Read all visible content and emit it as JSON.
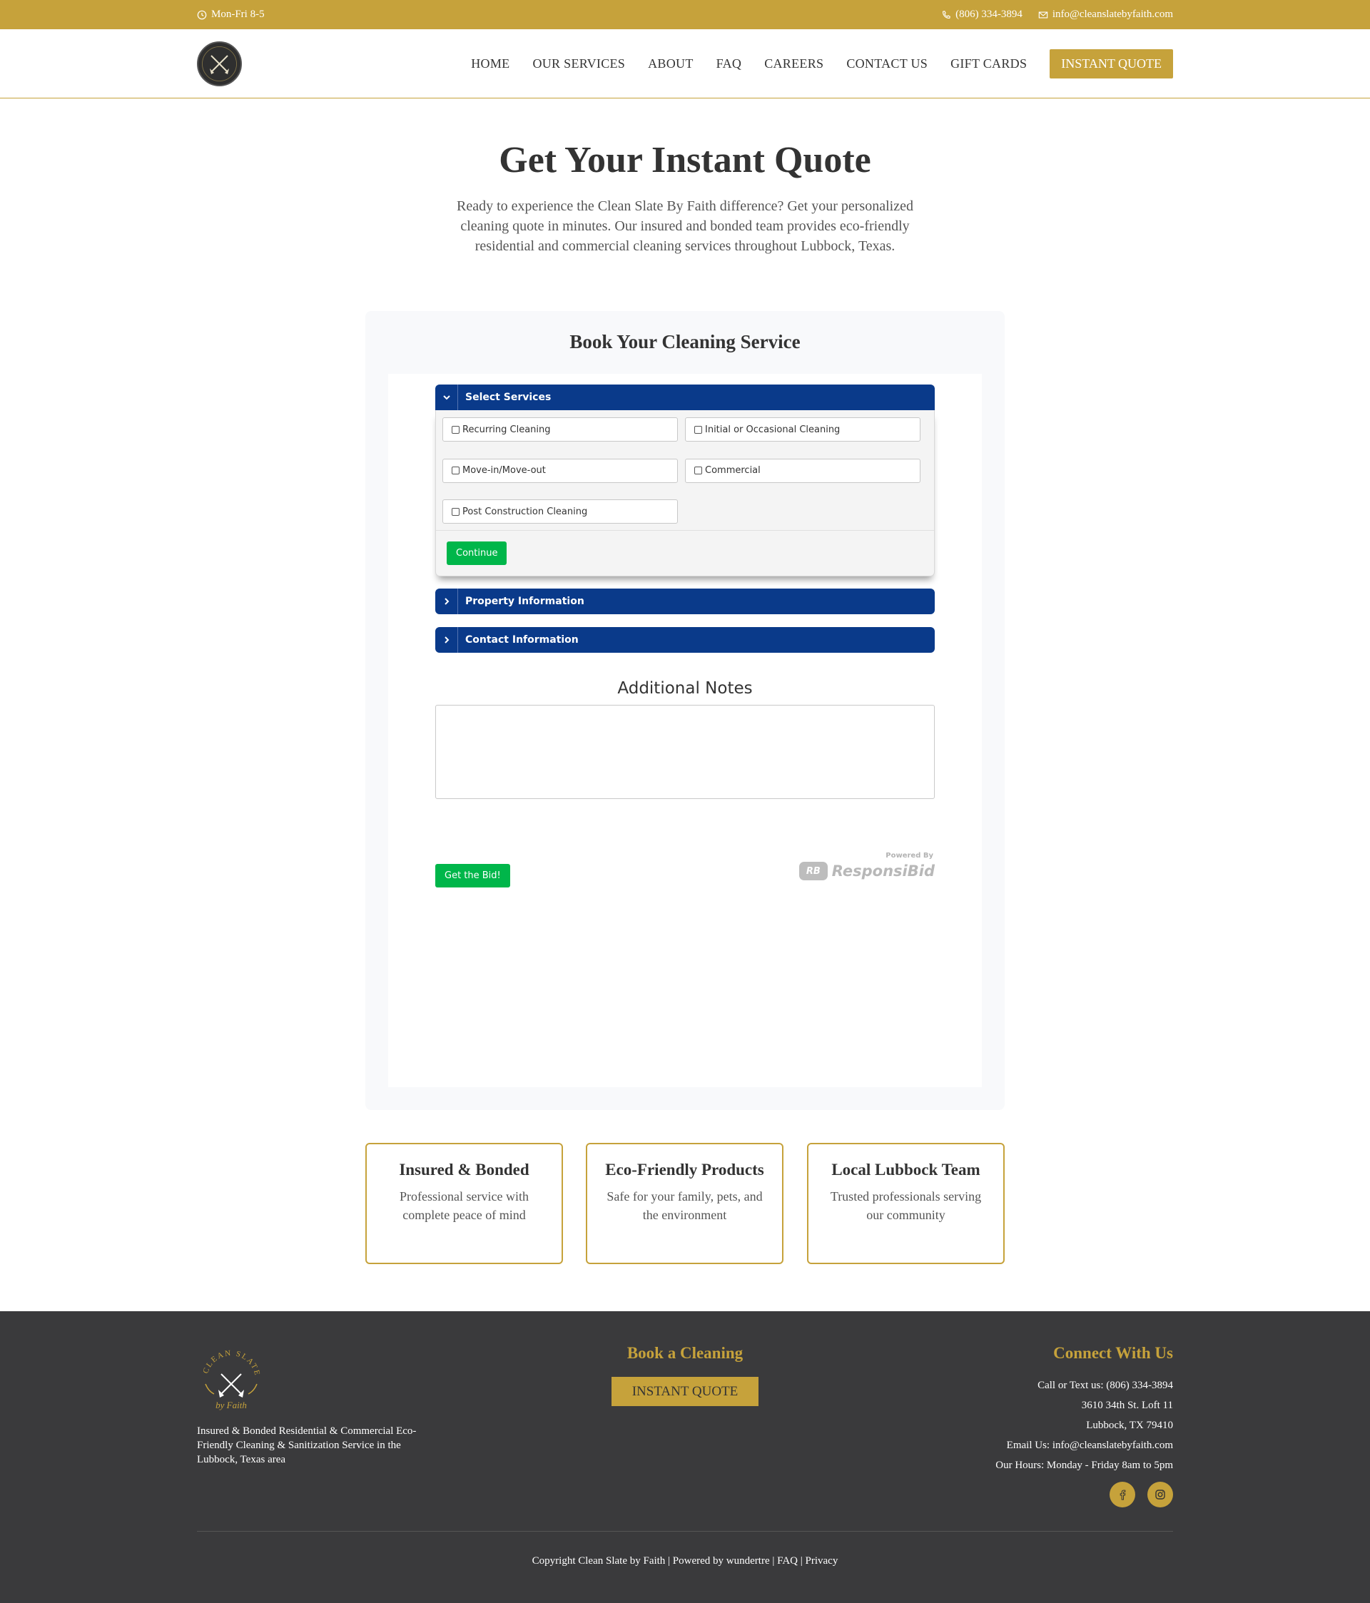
{
  "topbar": {
    "hours": "Mon-Fri 8-5",
    "phone": "(806) 334-3894",
    "email": "info@cleanslatebyfaith.com",
    "bg_color": "#c6a23b"
  },
  "header": {
    "nav": [
      "HOME",
      "OUR SERVICES",
      "ABOUT",
      "FAQ",
      "CAREERS",
      "CONTACT US",
      "GIFT CARDS"
    ],
    "cta": "INSTANT QUOTE"
  },
  "hero": {
    "title": "Get Your Instant Quote",
    "subtitle": "Ready to experience the Clean Slate By Faith difference? Get your personalized cleaning quote in minutes. Our insured and bonded team provides eco-friendly residential and commercial cleaning services throughout Lubbock, Texas."
  },
  "booking": {
    "title": "Book Your Cleaning Service",
    "sections": {
      "services": "Select Services",
      "property": "Property Information",
      "contact": "Contact Information"
    },
    "services": [
      "Recurring Cleaning",
      "Initial or Occasional Cleaning",
      "Move-in/Move-out",
      "Commercial",
      "Post Construction Cleaning"
    ],
    "continue_label": "Continue",
    "notes_title": "Additional Notes",
    "notes_value": "",
    "submit_label": "Get the Bid!",
    "powered_by": "Powered By",
    "powered_logo": "RB",
    "powered_brand": "ResponsiBid",
    "accent_color": "#0a3a8a",
    "button_color": "#00b64a"
  },
  "features": [
    {
      "title": "Insured & Bonded",
      "text": "Professional service with complete peace of mind"
    },
    {
      "title": "Eco-Friendly Products",
      "text": "Safe for your family, pets, and the environment"
    },
    {
      "title": "Local Lubbock Team",
      "text": "Trusted professionals serving our community"
    }
  ],
  "footer": {
    "logo_text": "CLEAN SLATE",
    "logo_script": "by Faith",
    "desc": "Insured & Bonded Residential & Commercial Eco-Friendly Cleaning & Sanitization Service in the Lubbock, Texas area",
    "book_title": "Book a Cleaning",
    "book_cta": "INSTANT QUOTE",
    "connect_title": "Connect With Us",
    "contact_lines": [
      "Call or Text us: (806) 334-3894",
      "3610 34th St. Loft 11",
      "Lubbock, TX 79410",
      "Email Us: info@cleanslatebyfaith.com",
      "Our Hours: Monday - Friday 8am to 5pm"
    ],
    "social_icons": [
      "facebook-icon",
      "instagram-icon"
    ],
    "copyright": "Copyright Clean Slate by Faith | Powered by wundertre | FAQ | Privacy",
    "bg_color": "#3a3a3c"
  }
}
